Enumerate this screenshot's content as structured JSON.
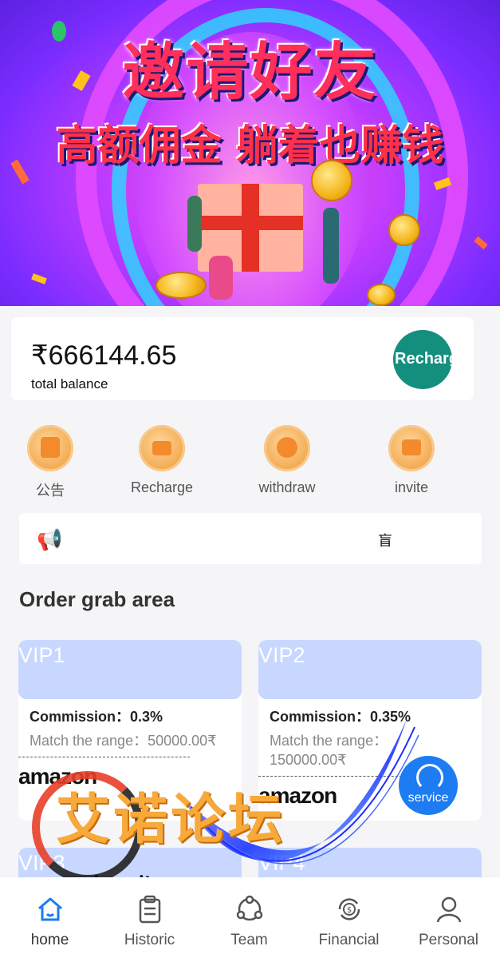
{
  "banner": {
    "title_line1": "邀请好友",
    "title_line2": "高额佣金 躺着也赚钱"
  },
  "balance": {
    "amount": "₹666144.65",
    "label": "total balance",
    "recharge_button": "Recharge"
  },
  "actions": [
    {
      "label": "公告",
      "icon": "announcement-icon"
    },
    {
      "label": "Recharge",
      "icon": "wallet-icon"
    },
    {
      "label": "withdraw",
      "icon": "medal-icon"
    },
    {
      "label": "invite",
      "icon": "invite-icon"
    }
  ],
  "notice": {
    "text": "盲"
  },
  "section_title": "Order grab area",
  "vip_cards": [
    {
      "level": "VIP1",
      "commission": "Commission：0.3%",
      "range": "Match the range：50000.00₹",
      "logo": "amazon"
    },
    {
      "level": "VIP2",
      "commission": "Commission：0.35%",
      "range": "Match the range：150000.00₹",
      "logo": "amazon"
    },
    {
      "level": "VIP3"
    },
    {
      "level": "VIP4"
    }
  ],
  "service": {
    "label": "service"
  },
  "watermark": {
    "text": "艾诺论坛",
    "url": "ainuo.it.com"
  },
  "tabs": [
    {
      "label": "home",
      "icon": "home-icon",
      "active": true
    },
    {
      "label": "Historic",
      "icon": "clipboard-icon"
    },
    {
      "label": "Team",
      "icon": "team-icon"
    },
    {
      "label": "Financial",
      "icon": "financial-icon"
    },
    {
      "label": "Personal",
      "icon": "person-icon"
    }
  ],
  "colors": {
    "accent": "#1d7cf2",
    "recharge": "#148f7e",
    "vip_header": "#c8d7ff",
    "action_icon": "#f2a950"
  }
}
